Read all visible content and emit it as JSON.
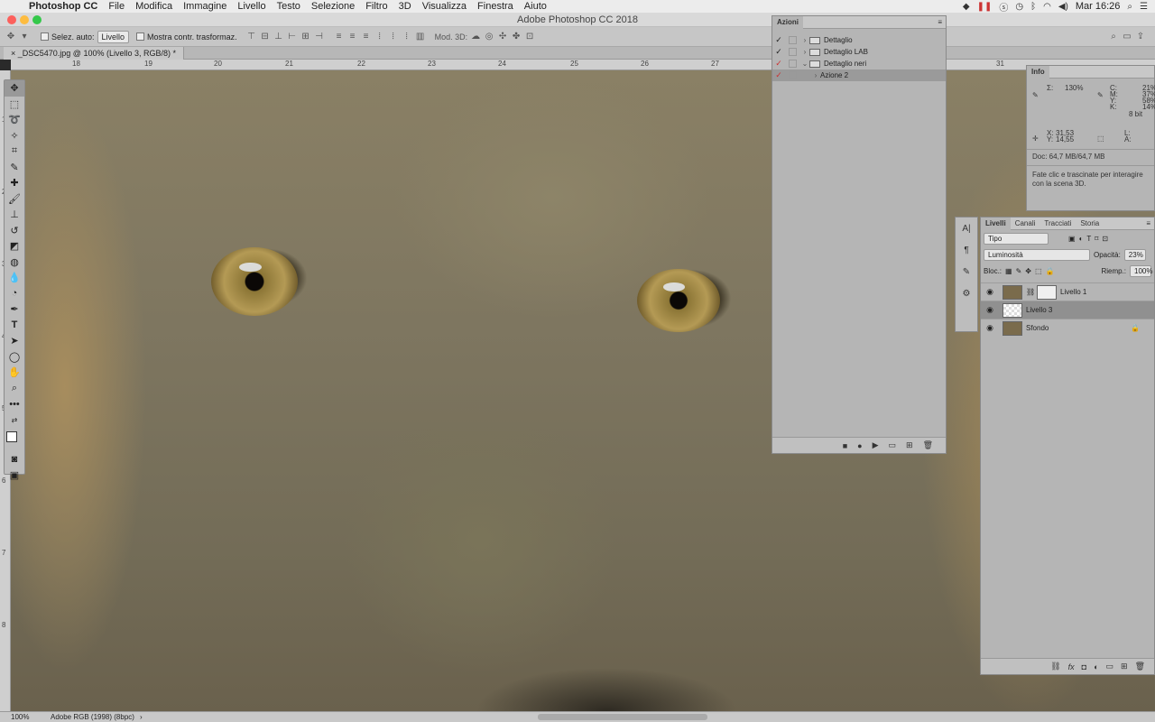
{
  "menubar": {
    "app_name": "Photoshop CC",
    "items": [
      "File",
      "Modifica",
      "Immagine",
      "Livello",
      "Testo",
      "Selezione",
      "Filtro",
      "3D",
      "Visualizza",
      "Finestra",
      "Aiuto"
    ],
    "clock": "Mar 16:26"
  },
  "window": {
    "title": "Adobe Photoshop CC 2018"
  },
  "options_bar": {
    "auto_select_label": "Selez. auto:",
    "auto_select_value": "Livello",
    "transform_label": "Mostra contr. trasformaz.",
    "mode3d_label": "Mod. 3D:"
  },
  "document": {
    "tab_title": "_DSC5470.jpg @ 100% (Livello 3, RGB/8) *",
    "ruler_marks": [
      "18",
      "19",
      "20",
      "21",
      "22",
      "23",
      "24",
      "25",
      "26",
      "27",
      "28",
      "29",
      "30",
      "31"
    ],
    "left_ruler_marks": [
      "1",
      "2",
      "3",
      "4",
      "5",
      "6",
      "7",
      "8"
    ]
  },
  "actions_panel": {
    "title": "Azioni",
    "items": [
      {
        "label": "Dettaglio",
        "expanded": false
      },
      {
        "label": "Dettaglio LAB",
        "expanded": false
      },
      {
        "label": "Dettaglio neri",
        "expanded": true
      },
      {
        "label": "Azione 2",
        "expanded": false,
        "selected": true
      }
    ]
  },
  "info_panel": {
    "title": "Info",
    "sigma": "Σ:",
    "sigma_value": "130%",
    "c_label": "C:",
    "c_value": "21%",
    "m_label": "M:",
    "m_value": "37%",
    "y_label": "Y:",
    "y_value": "58%",
    "k_label": "K:",
    "k_value": "14%",
    "bits": "8 bit",
    "x_label": "X:",
    "x_value": "31,53",
    "y2_label": "Y:",
    "y2_value": "14,55",
    "l_label": "L:",
    "a_label": "A:",
    "doc_size": "Doc: 64,7 MB/64,7 MB",
    "hint": "Fate clic e trascinate per interagire con la scena 3D."
  },
  "layers_panel": {
    "tabs": [
      "Livelli",
      "Canali",
      "Tracciati",
      "Storia"
    ],
    "kind_filter": "Tipo",
    "blend_mode": "Luminosità",
    "opacity_label": "Opacità:",
    "opacity_value": "23%",
    "lock_label": "Bloc.:",
    "fill_label": "Riemp.:",
    "fill_value": "100%",
    "layers": [
      {
        "name": "Livello 1",
        "selected": false
      },
      {
        "name": "Livello 3",
        "selected": true
      },
      {
        "name": "Sfondo",
        "selected": false
      }
    ]
  },
  "status_bar": {
    "zoom": "100%",
    "profile": "Adobe RGB (1998) (8bpc)"
  },
  "colors": {
    "accent_red": "#cc3333",
    "panel_bg": "#b5b5b5"
  }
}
